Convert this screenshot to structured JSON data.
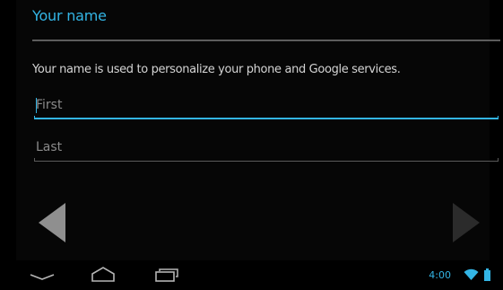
{
  "setup": {
    "title": "Your name",
    "description": "Your name is used to personalize your phone and Google services."
  },
  "form": {
    "first": {
      "value": "",
      "placeholder": "First",
      "focused": true
    },
    "last": {
      "value": "",
      "placeholder": "Last",
      "focused": false
    }
  },
  "navigation": {
    "prev_icon": "arrow-left-icon",
    "next_icon": "arrow-right-icon",
    "prev_enabled": true,
    "next_enabled": false
  },
  "system_bar": {
    "back_icon": "back-icon",
    "home_icon": "home-icon",
    "recents_icon": "recent-apps-icon",
    "time": "4:00",
    "wifi_icon": "wifi-icon",
    "battery_icon": "battery-icon"
  },
  "colors": {
    "accent": "#33b5e5",
    "background": "#000000",
    "text": "#d4d4d4",
    "hint": "#8a8a8a",
    "divider": "#5c5c5c"
  }
}
